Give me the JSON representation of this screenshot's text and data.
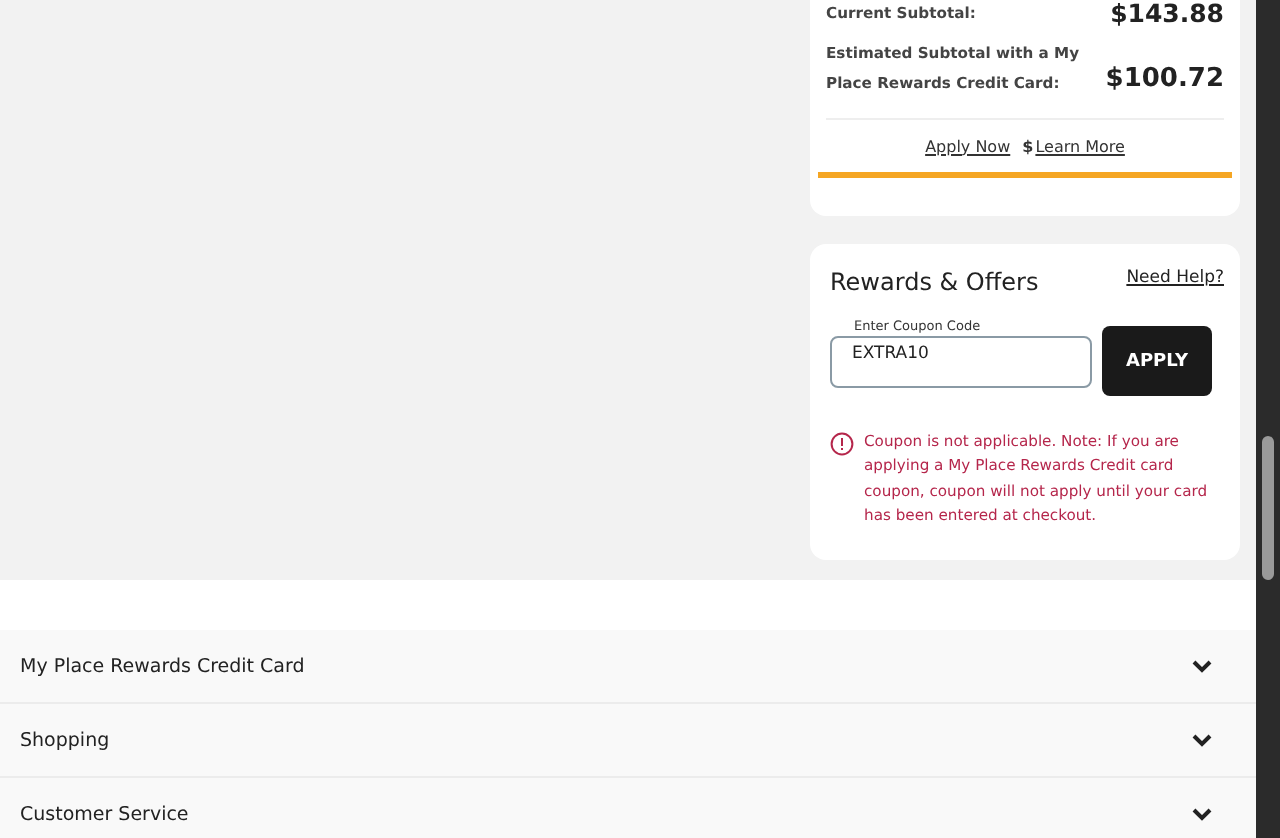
{
  "summary": {
    "current_label": "Current Subtotal:",
    "current_value": "$143.88",
    "estimated_label": "Estimated Subtotal with a My Place Rewards Credit Card:",
    "estimated_value": "$100.72",
    "apply_link": "Apply Now",
    "learn_icon": "$",
    "learn_link": "Learn More"
  },
  "rewards": {
    "title": "Rewards & Offers",
    "help_link": "Need Help?",
    "coupon": {
      "label": "Enter Coupon Code",
      "value": "EXTRA10"
    },
    "apply_button": "APPLY",
    "error": "Coupon is not applicable. Note: If you are applying a My Place Rewards Credit card coupon, coupon will not apply until your card has been entered at checkout."
  },
  "footer": [
    {
      "label": "My Place Rewards Credit Card",
      "expanded": false
    },
    {
      "label": "Shopping",
      "expanded": false
    },
    {
      "label": "Customer Service",
      "expanded": false
    }
  ]
}
